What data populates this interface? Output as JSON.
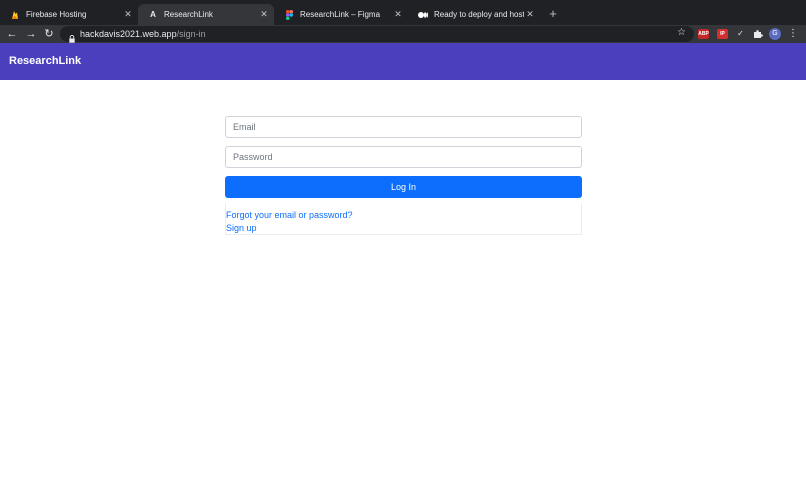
{
  "browser": {
    "tabs": [
      {
        "title": "Firebase Hosting",
        "active": false,
        "favicon": "fire-icon"
      },
      {
        "title": "ResearchLink",
        "active": true,
        "favicon": "letter-a-icon"
      },
      {
        "title": "ResearchLink – Figma",
        "active": false,
        "favicon": "figma-icon"
      },
      {
        "title": "Ready to deploy and host your",
        "active": false,
        "favicon": "medium-icon"
      }
    ],
    "url_host": "hackdavis2021.web.app",
    "url_path": "/sign-in",
    "extensions": [
      "ABP",
      "IP",
      "✓"
    ],
    "avatar_letter": "G"
  },
  "navbar": {
    "brand": "ResearchLink"
  },
  "signin": {
    "email_placeholder": "Email",
    "password_placeholder": "Password",
    "login_label": "Log In",
    "forgot_link": "Forgot your email or password?",
    "signup_link": "Sign up"
  },
  "colors": {
    "navbar": "#4a3fbd",
    "primary": "#0d6efd"
  }
}
